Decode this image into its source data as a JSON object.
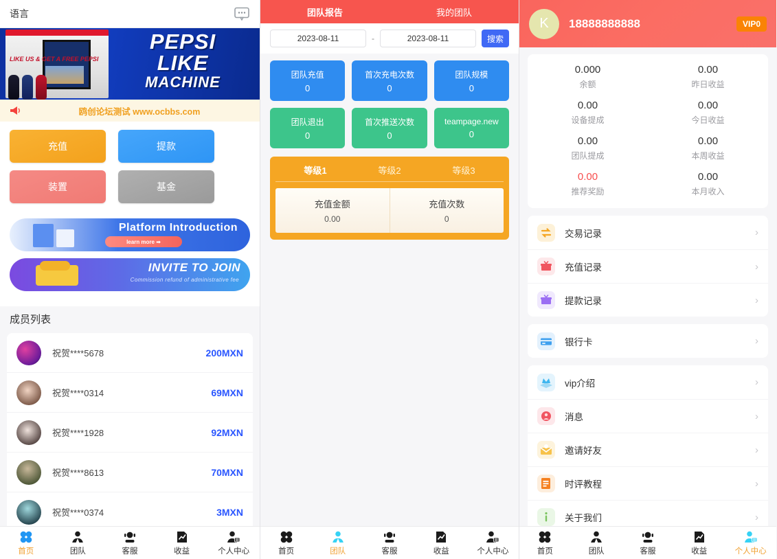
{
  "left": {
    "lang_label": "语言",
    "chat_icon": "chat-bubble-icon",
    "hero": {
      "line1": "PEPSI",
      "line2": "LIKE",
      "line3": "MACHINE",
      "badge": "LIKE US & GET A FREE PEPSI"
    },
    "notice": {
      "icon": "megaphone-icon",
      "text": "鸥创论坛测试 www.ocbbs.com"
    },
    "quick_buttons": [
      {
        "label": "充值",
        "color": "#f7ab28"
      },
      {
        "label": "提款",
        "color": "#3b9ef8"
      },
      {
        "label": "装置",
        "color": "#f2807a"
      },
      {
        "label": "基金",
        "color": "#a5a5a5"
      }
    ],
    "banners": [
      {
        "title": "Platform Introduction",
        "pill": "learn more ➡",
        "sub": ""
      },
      {
        "title": "INVITE TO JOIN",
        "pill": "",
        "sub": "Commission refund of administrative fee"
      }
    ],
    "members_title": "成员列表",
    "members": [
      {
        "name": "祝贺****5678",
        "amount": "200MXN",
        "avatar": "#b2238f"
      },
      {
        "name": "祝贺****0314",
        "amount": "69MXN",
        "avatar": "#d8c0b4"
      },
      {
        "name": "祝贺****1928",
        "amount": "92MXN",
        "avatar": "#cfd9de"
      },
      {
        "name": "祝贺****8613",
        "amount": "70MXN",
        "avatar": "#4d5a3a"
      },
      {
        "name": "祝贺****0374",
        "amount": "3MXN",
        "avatar": "#2d6f7a"
      }
    ],
    "tabbar": [
      {
        "label": "首页",
        "icon": "grid-icon",
        "active": true
      },
      {
        "label": "团队",
        "icon": "team-icon",
        "active": false
      },
      {
        "label": "客服",
        "icon": "headset-icon",
        "active": false
      },
      {
        "label": "收益",
        "icon": "chart-doc-icon",
        "active": false
      },
      {
        "label": "个人中心",
        "icon": "user-card-icon",
        "active": false
      }
    ]
  },
  "mid": {
    "tabs": [
      {
        "label": "团队报告",
        "active": true
      },
      {
        "label": "我的团队",
        "active": false
      }
    ],
    "date_from": "2023-08-11",
    "date_separator": "-",
    "date_to": "2023-08-11",
    "search_label": "搜索",
    "stats": [
      {
        "label": "团队充值",
        "value": "0",
        "color": "blue"
      },
      {
        "label": "首次充电次数",
        "value": "0",
        "color": "blue"
      },
      {
        "label": "团队规模",
        "value": "0",
        "color": "blue"
      },
      {
        "label": "团队退出",
        "value": "0",
        "color": "green"
      },
      {
        "label": "首次推送次数",
        "value": "0",
        "color": "green"
      },
      {
        "label": "teampage.new",
        "value": "0",
        "color": "green"
      }
    ],
    "levels": [
      {
        "label": "等级1",
        "active": true
      },
      {
        "label": "等级2",
        "active": false
      },
      {
        "label": "等级3",
        "active": false
      }
    ],
    "level_stats": [
      {
        "label": "充值金额",
        "value": "0.00"
      },
      {
        "label": "充值次数",
        "value": "0"
      }
    ],
    "tabbar": [
      {
        "label": "首页",
        "icon": "grid-icon",
        "active": false
      },
      {
        "label": "团队",
        "icon": "team-icon",
        "active": true
      },
      {
        "label": "客服",
        "icon": "headset-icon",
        "active": false
      },
      {
        "label": "收益",
        "icon": "chart-doc-icon",
        "active": false
      },
      {
        "label": "个人中心",
        "icon": "user-card-icon",
        "active": false
      }
    ]
  },
  "right": {
    "avatar_letter": "K",
    "phone": "18888888888",
    "vip_badge": "VIP0",
    "balances": [
      {
        "value": "0.000",
        "label": "余额",
        "red": false
      },
      {
        "value": "0.00",
        "label": "昨日收益",
        "red": false
      },
      {
        "value": "0.00",
        "label": "设备提成",
        "red": false
      },
      {
        "value": "0.00",
        "label": "今日收益",
        "red": false
      },
      {
        "value": "0.00",
        "label": "团队提成",
        "red": false
      },
      {
        "value": "0.00",
        "label": "本周收益",
        "red": false
      },
      {
        "value": "0.00",
        "label": "推荐奖励",
        "red": true
      },
      {
        "value": "0.00",
        "label": "本月收入",
        "red": false
      }
    ],
    "menu_groups": [
      [
        {
          "label": "交易记录",
          "icon": "exchange-icon",
          "bg": "#fdf1d8",
          "fg": "#f5a623"
        },
        {
          "label": "充值记录",
          "icon": "deposit-icon",
          "bg": "#fde8ea",
          "fg": "#f0555f"
        },
        {
          "label": "提款记录",
          "icon": "withdraw-icon",
          "bg": "#f0e9fd",
          "fg": "#9b6ef3"
        }
      ],
      [
        {
          "label": "银行卡",
          "icon": "bank-card-icon",
          "bg": "#e3f1fd",
          "fg": "#3fa0ef"
        }
      ],
      [
        {
          "label": "vip介绍",
          "icon": "vip-icon",
          "bg": "#e4f4fd",
          "fg": "#3fb6ef"
        },
        {
          "label": "消息",
          "icon": "message-icon",
          "bg": "#fde7ea",
          "fg": "#f05561"
        },
        {
          "label": "邀请好友",
          "icon": "invite-icon",
          "bg": "#fdf3dc",
          "fg": "#f7c24b"
        },
        {
          "label": "时评教程",
          "icon": "tutorial-icon",
          "bg": "#fdeedd",
          "fg": "#f58122"
        },
        {
          "label": "关于我们",
          "icon": "info-icon",
          "bg": "#eaf7e6",
          "fg": "#7bc45f"
        }
      ]
    ],
    "chevron": "›",
    "tabbar": [
      {
        "label": "首页",
        "icon": "grid-icon",
        "active": false
      },
      {
        "label": "团队",
        "icon": "team-icon",
        "active": false
      },
      {
        "label": "客服",
        "icon": "headset-icon",
        "active": false
      },
      {
        "label": "收益",
        "icon": "chart-doc-icon",
        "active": false
      },
      {
        "label": "个人中心",
        "icon": "user-card-icon",
        "active": true
      }
    ]
  }
}
